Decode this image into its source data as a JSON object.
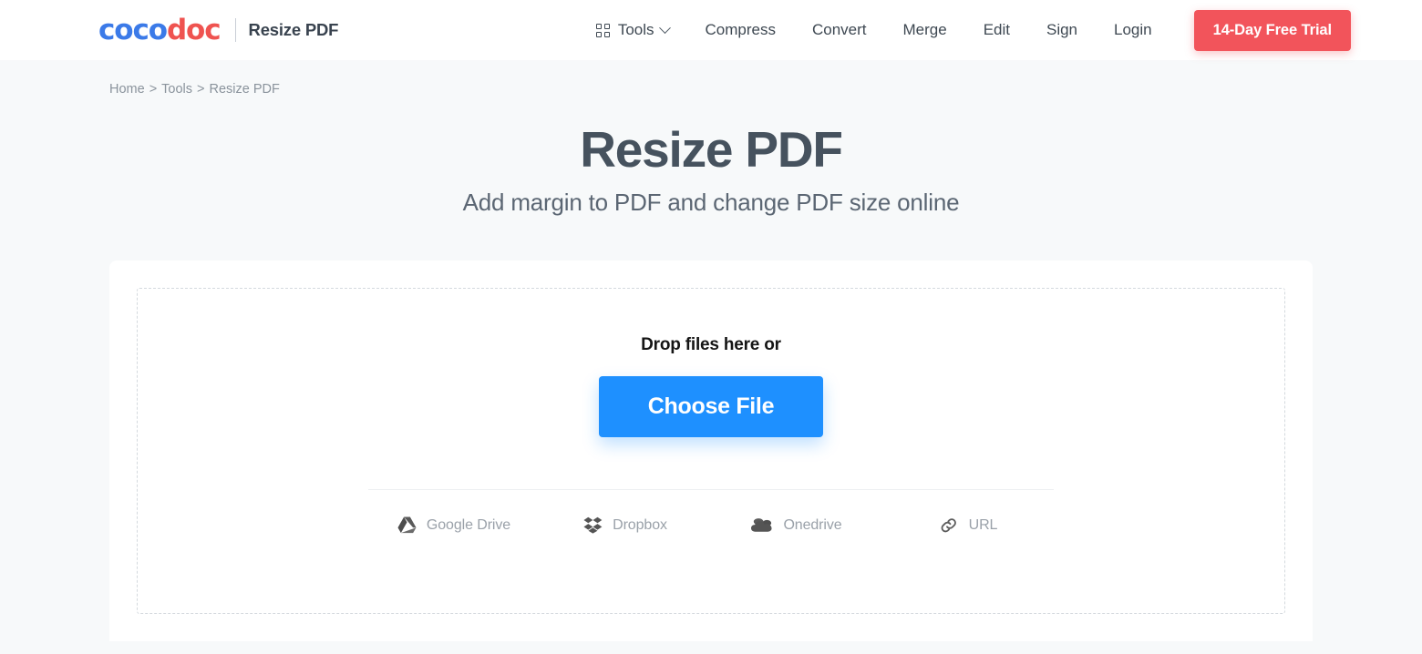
{
  "header": {
    "logo": {
      "part1": "coco",
      "part2": "doc",
      "color1": "#3b7ae8",
      "color2": "#ef5350"
    },
    "brand_title": "Resize PDF",
    "nav": [
      {
        "label": "Tools",
        "icon": "grid-icon",
        "has_dropdown": true
      },
      {
        "label": "Compress",
        "icon": null,
        "has_dropdown": false
      },
      {
        "label": "Convert",
        "icon": null,
        "has_dropdown": false
      },
      {
        "label": "Merge",
        "icon": null,
        "has_dropdown": false
      },
      {
        "label": "Edit",
        "icon": null,
        "has_dropdown": false
      },
      {
        "label": "Sign",
        "icon": null,
        "has_dropdown": false
      },
      {
        "label": "Login",
        "icon": null,
        "has_dropdown": false
      }
    ],
    "trial_button": {
      "label": "14-Day Free Trial",
      "color": "#f2545b"
    }
  },
  "breadcrumb": {
    "items": [
      "Home",
      "Tools",
      "Resize PDF"
    ],
    "separator": ">"
  },
  "hero": {
    "title": "Resize PDF",
    "subtitle": "Add margin to PDF and change PDF size online"
  },
  "upload": {
    "drop_label": "Drop files here or",
    "choose_button": {
      "label": "Choose File",
      "color": "#1e90ff"
    },
    "sources": [
      {
        "label": "Google Drive",
        "icon": "google-drive-icon"
      },
      {
        "label": "Dropbox",
        "icon": "dropbox-icon"
      },
      {
        "label": "Onedrive",
        "icon": "onedrive-icon"
      },
      {
        "label": "URL",
        "icon": "link-icon"
      }
    ]
  }
}
